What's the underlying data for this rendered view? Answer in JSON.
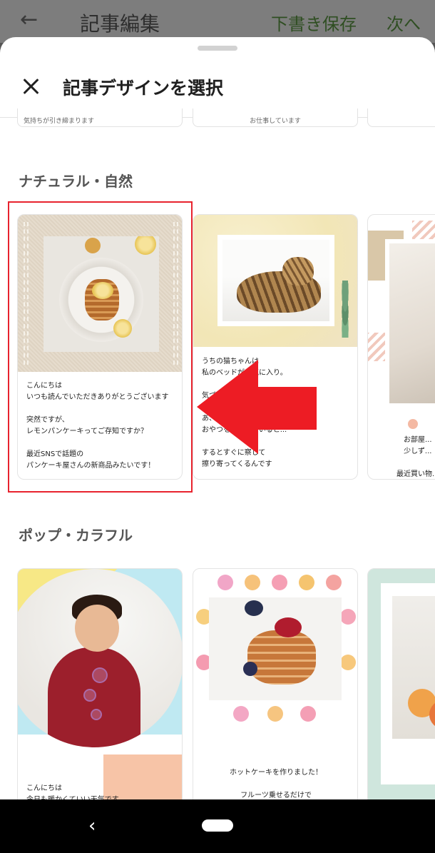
{
  "background_header": {
    "back_icon": "arrow-left-icon",
    "title": "記事編集",
    "save_draft": "下書き保存",
    "next": "次へ"
  },
  "sheet": {
    "title": "記事デザインを選択",
    "close_icon": "close-icon"
  },
  "top_partial_cards": [
    {
      "text": "気持ちが引き締まります"
    },
    {
      "text": "お仕事しています"
    }
  ],
  "sections": [
    {
      "title": "ナチュラル・自然",
      "cards": [
        {
          "text": "こんにちは\nいつも読んでいただきありがとうございます\n\n突然ですが、\nレモンパンケーキってご存知ですか？\n\n最近SNSで話題の\nパンケーキ屋さんの新商品みたいです！"
        },
        {
          "text": "うちの猫ちゃんは\n私のベッドがお気に入り。\n\n気づくと...\n\nあ、そろそろおやつの時間\nおやつを準備していると...\n\nするとすぐに察して\n擦り寄ってくるんです"
        },
        {
          "text": "お部屋...\n少しず...\n\n最近買い物..."
        }
      ]
    },
    {
      "title": "ポップ・カラフル",
      "cards": [
        {
          "text": "こんにちは\n今日も暖かくていい天気です\n\n今日の娘ちゃんは\nシャボン玉に夢中"
        },
        {
          "text": "ホットケーキを作りました！\n\nフルーツ乗せるだけで\nお店で売ってるみたいになりました\n\nたくさん作ったので"
        },
        {
          "text": ""
        }
      ]
    }
  ],
  "annotation": {
    "highlight_color": "#e8232e",
    "arrow_color": "#ed1c24"
  },
  "navbar": {
    "back_icon": "nav-back-icon",
    "home_icon": "nav-home-pill"
  }
}
